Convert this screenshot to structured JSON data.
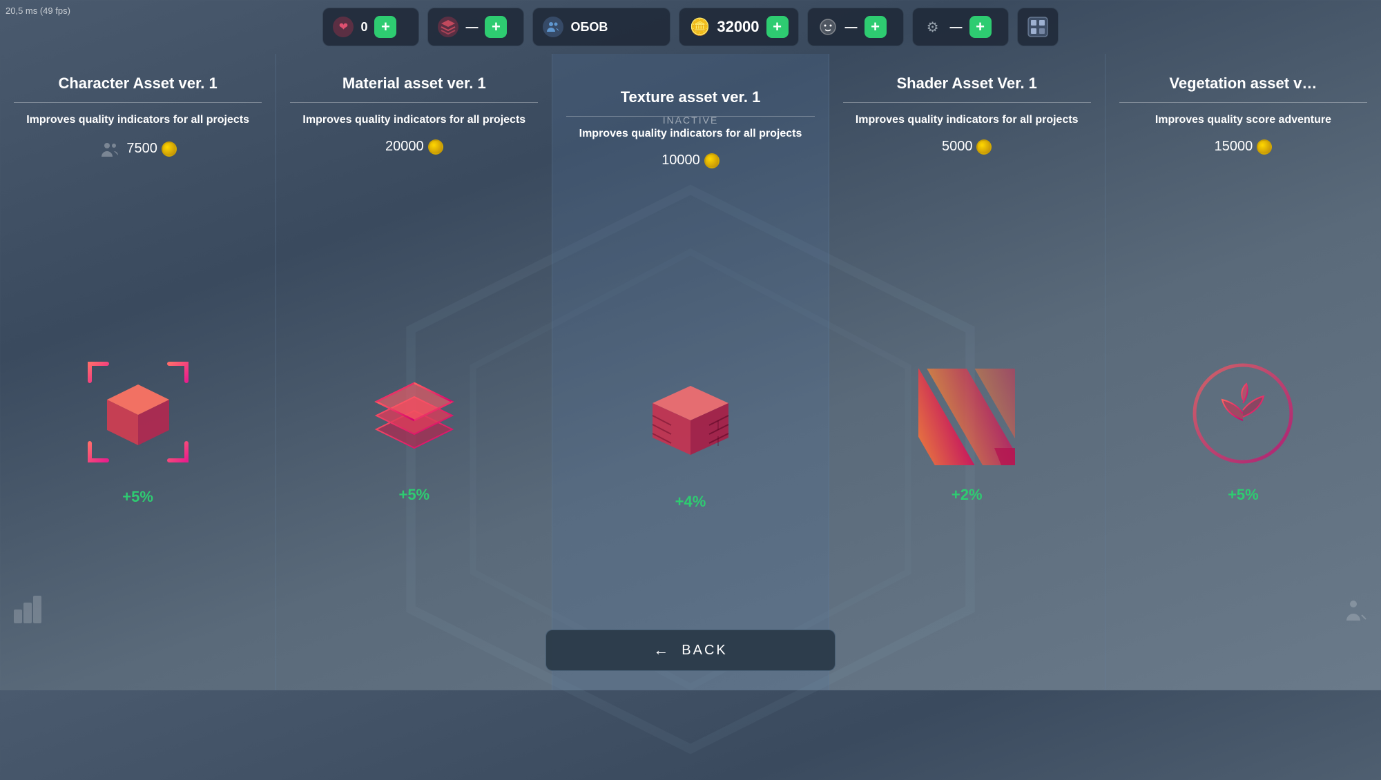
{
  "perf": "20,5 ms (49 fps)",
  "hud": {
    "heart": {
      "icon": "❤",
      "value": "0"
    },
    "layers": {
      "icon": "≡",
      "value": ""
    },
    "users": {
      "icon": "⚙",
      "value": "ОБОВ"
    },
    "currency": {
      "icon": "🪙",
      "value": "32000",
      "add": "+"
    },
    "face": {
      "icon": "😐",
      "value": ""
    },
    "settings": {
      "icon": "⚙",
      "value": ""
    },
    "profile": {
      "icon": "🎮"
    }
  },
  "inactive_label": "INACTIVE",
  "cards": [
    {
      "title": "Character Asset ver. 1",
      "desc": "Improves quality indicators for all projects",
      "price": "7500",
      "bonus": "+5%",
      "icon_type": "cube",
      "has_user_icon": true,
      "has_rank": true
    },
    {
      "title": "Material asset ver. 1",
      "desc": "Improves quality indicators for all projects",
      "price": "20000",
      "bonus": "+5%",
      "icon_type": "layers",
      "has_user_icon": false,
      "has_rank": false
    },
    {
      "title": "Texture asset ver. 1",
      "desc": "Improves quality indicators for all projects",
      "price": "10000",
      "bonus": "+4%",
      "icon_type": "bricks",
      "has_user_icon": false,
      "has_rank": false,
      "active": true
    },
    {
      "title": "Shader Asset Ver. 1",
      "desc": "Improves quality indicators for all projects",
      "price": "5000",
      "bonus": "+2%",
      "icon_type": "shader",
      "has_user_icon": false,
      "has_rank": false
    },
    {
      "title": "Vegetation asset v…",
      "desc": "Improves quality score adventure",
      "price": "15000",
      "bonus": "+5%",
      "icon_type": "plant",
      "has_user_icon": false,
      "has_rank": false
    }
  ],
  "back_button": {
    "arrow": "←",
    "label": "BACK"
  }
}
